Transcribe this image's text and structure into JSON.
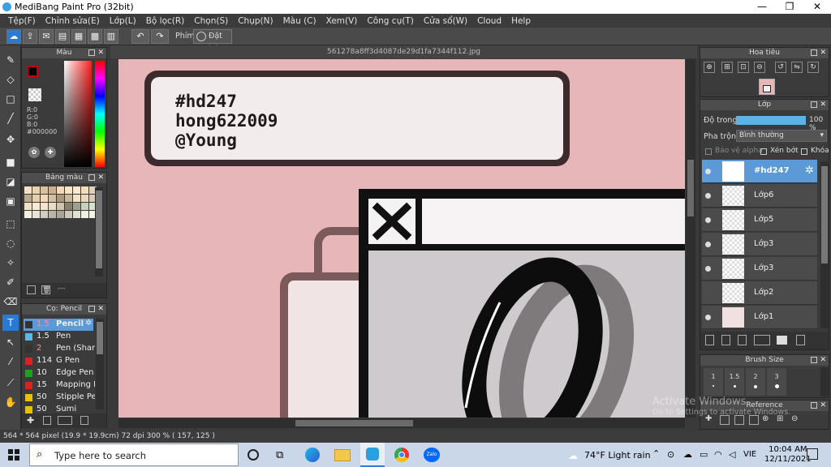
{
  "window": {
    "title": "MediBang Paint Pro (32bit)",
    "minimize": "—",
    "restore": "❐",
    "close": "✕"
  },
  "menu": [
    "Tệp(F)",
    "Chỉnh sửa(E)",
    "Lớp(L)",
    "Bộ lọc(R)",
    "Chọn(S)",
    "Chụp(N)",
    "Màu (C)",
    "Xem(V)",
    "Công cụ(T)",
    "Cửa sổ(W)",
    "Cloud",
    "Help"
  ],
  "toolbar": {
    "key_label": "Phím",
    "reset_label": "Đặt lại"
  },
  "color_panel": {
    "title": "Màu",
    "r": "R:0",
    "g": "G:0",
    "b": "B:0",
    "hex": "#000000",
    "primary_color": "#000000",
    "accent_color": "#c0000c"
  },
  "palette_panel": {
    "title": "Bảng màu",
    "swatches": [
      "#f2e3c8",
      "#e8d3b0",
      "#d8c0a0",
      "#c8b090",
      "#f4d8b8",
      "#f8e4c8",
      "#fbe9d2",
      "#f5dcc0",
      "#e0d0bf",
      "#b8a890",
      "#e6cfb0",
      "#f0d8b8",
      "#d0c0a8",
      "#a89880",
      "#c8b8a0",
      "#f2e2c8",
      "#e8d8c0",
      "#d8ccb8",
      "#f0e0c8",
      "#f8ecd8",
      "#f4e4d0",
      "#e8dcc8",
      "#d0c4b0",
      "#888070",
      "#a0a090",
      "#c8d0c0",
      "#d8e0d0",
      "#f4f0e0",
      "#e8e4d8",
      "#d0ccc0",
      "#b8b4a8",
      "#a8a498",
      "#c8c8bc",
      "#e0e0d4",
      "#f0f0e8",
      "#f6f3ec"
    ],
    "dots": "---"
  },
  "brush_panel": {
    "title": "Cọ: Pencil",
    "brushes": [
      {
        "size": "1.5",
        "name": "Pencil",
        "color": "#333333"
      },
      {
        "size": "1.5",
        "name": "Pen",
        "color": "#5bb7e8"
      },
      {
        "size": "2",
        "name": "Pen (Sharp)",
        "color": "#333333"
      },
      {
        "size": "114",
        "name": "G Pen",
        "color": "#e02020"
      },
      {
        "size": "10",
        "name": "Edge Pen",
        "color": "#20a020"
      },
      {
        "size": "15",
        "name": "Mapping Pen",
        "color": "#e02020"
      },
      {
        "size": "50",
        "name": "Stipple Pen",
        "color": "#e8c000"
      },
      {
        "size": "50",
        "name": "Sumi",
        "color": "#e8c000"
      }
    ]
  },
  "canvas": {
    "filename": "561278a8ff3d4087de29d1fa7344f112.jpg",
    "text_lines": [
      "#hd247",
      "hong622009",
      "@Young"
    ]
  },
  "navigator_panel": {
    "title": "Hoa tiêu"
  },
  "layer_panel": {
    "title": "Lớp",
    "opacity_label": "Độ trong",
    "opacity_value": "100 %",
    "opacity": 100,
    "blend_label": "Pha trộn",
    "blend_value": "Bình thường",
    "protect_alpha": "Bảo vệ alpha",
    "clipping": "Xén bớt",
    "lock": "Khóa",
    "layers": [
      {
        "name": "#hd247",
        "selected": true
      },
      {
        "name": "Lớp6",
        "selected": false
      },
      {
        "name": "Lớp5",
        "selected": false
      },
      {
        "name": "Lớp3",
        "selected": false
      },
      {
        "name": "Lớp3",
        "selected": false
      },
      {
        "name": "Lớp2",
        "selected": false
      },
      {
        "name": "Lớp1",
        "selected": false
      }
    ]
  },
  "brush_size_panel": {
    "title": "Brush Size",
    "sizes": [
      "1",
      "1.5",
      "2",
      "3"
    ]
  },
  "reference_panel": {
    "title": "Reference"
  },
  "watermark": {
    "line1": "Activate Windows",
    "line2": "Go to Settings to activate Windows."
  },
  "statusbar": {
    "text": "564 * 564 pixel   (19.9 * 19.9cm)   72 dpi   300 %   ( 157, 125 )"
  },
  "taskbar": {
    "search_placeholder": "Type here to search",
    "weather": "74°F  Light rain",
    "lang": "VIE",
    "time": "10:04 AM",
    "date": "12/11/2021"
  }
}
